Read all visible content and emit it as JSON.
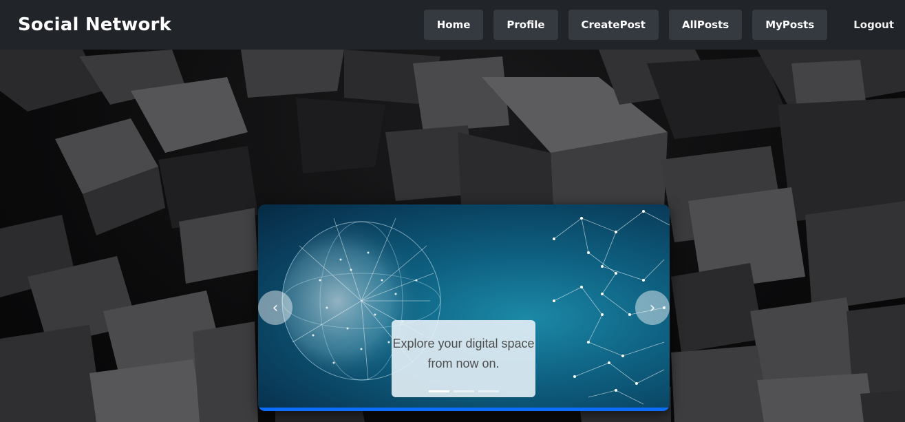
{
  "brand": {
    "name": "Social Network"
  },
  "nav": {
    "items": [
      {
        "label": "Home"
      },
      {
        "label": "Profile"
      },
      {
        "label": "CreatePost"
      },
      {
        "label": "AllPosts"
      },
      {
        "label": "MyPosts"
      }
    ],
    "logout_label": "Logout"
  },
  "carousel": {
    "caption": "Explore your digital space from now on.",
    "slide_count": 3,
    "active_slide": 1,
    "prev_icon": "chevron-left-icon",
    "next_icon": "chevron-right-icon"
  },
  "colors": {
    "navbar_bg": "#212529",
    "nav_button_bg": "#343a40",
    "carousel_accent": "#0d6efd"
  }
}
